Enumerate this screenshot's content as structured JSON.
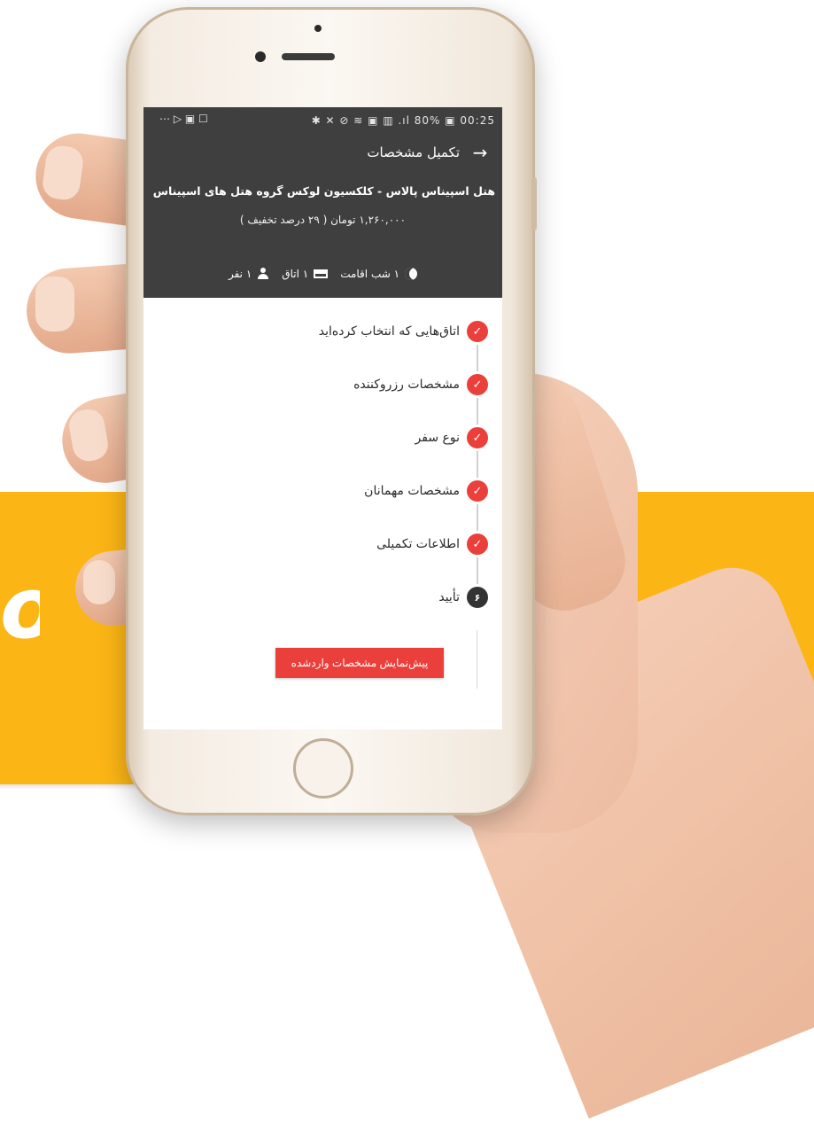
{
  "status_bar": {
    "left_icons": "⋯ ▷ ▣ ☐",
    "right": "✱ ✕ ⊘ ≋ ▣ ▥ .ıl 80% ▣ 00:25"
  },
  "header": {
    "title": "تکمیل مشخصات",
    "hotel_name": "هتل اسپیناس پالاس - کلکسیون لوکس گروه هتل های اسپیناس",
    "price": "۱,۲۶۰,۰۰۰ تومان ( ۲۹ درصد تخفیف )",
    "nights": "۱ شب اقامت",
    "rooms": "۱ اتاق",
    "people": "۱ نفر"
  },
  "steps": [
    {
      "label": "اتاق‌هایی که انتخاب کرده‌اید",
      "state": "done"
    },
    {
      "label": "مشخصات رزروکننده",
      "state": "done"
    },
    {
      "label": "نوع سفر",
      "state": "done"
    },
    {
      "label": "مشخصات مهمانان",
      "state": "done"
    },
    {
      "label": "اطلاعات تکمیلی",
      "state": "done"
    },
    {
      "label": "تأیید",
      "state": "pending",
      "number": "۶"
    }
  ],
  "submit_label": "پیش‌نمایش مشخصات واردشده",
  "banner_text": "o!",
  "colors": {
    "accent": "#ea3f3b",
    "header_bg": "#3f3f3f",
    "banner": "#fbb515"
  },
  "icons": {
    "back": "arrow-right-icon",
    "check": "check-icon",
    "moon": "moon-icon",
    "bed": "bed-icon",
    "person": "person-icon"
  }
}
